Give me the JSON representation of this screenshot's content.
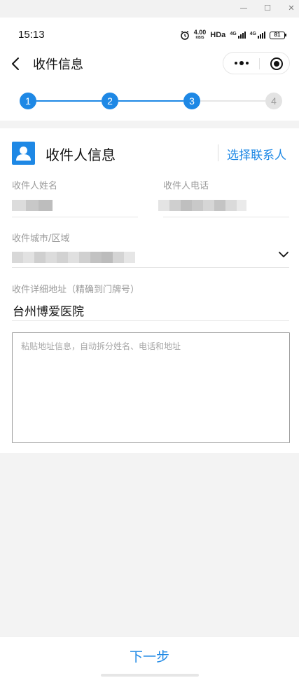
{
  "window": {
    "minimize": "—",
    "maximize": "☐",
    "close": "✕"
  },
  "status_bar": {
    "time": "15:13",
    "speed_value": "4.00",
    "speed_unit": "KB/S",
    "hd": "HDa",
    "signal1": "4G",
    "signal2": "4G",
    "battery": "81"
  },
  "nav": {
    "title": "收件信息"
  },
  "stepper": {
    "steps": [
      "1",
      "2",
      "3",
      "4"
    ],
    "current_step": 3
  },
  "section": {
    "title": "收件人信息",
    "contact_link": "选择联系人"
  },
  "form": {
    "name_label": "收件人姓名",
    "phone_label": "收件人电话",
    "city_label": "收件城市/区域",
    "address_label": "收件详细地址（精确到门牌号）",
    "address_value": "台州博爱医院",
    "paste_placeholder": "粘贴地址信息，自动拆分姓名、电话和地址"
  },
  "footer": {
    "next_label": "下一步"
  },
  "colors": {
    "accent": "#1e88e5",
    "inactive": "#e3e3e3",
    "background": "#f3f3f3"
  }
}
